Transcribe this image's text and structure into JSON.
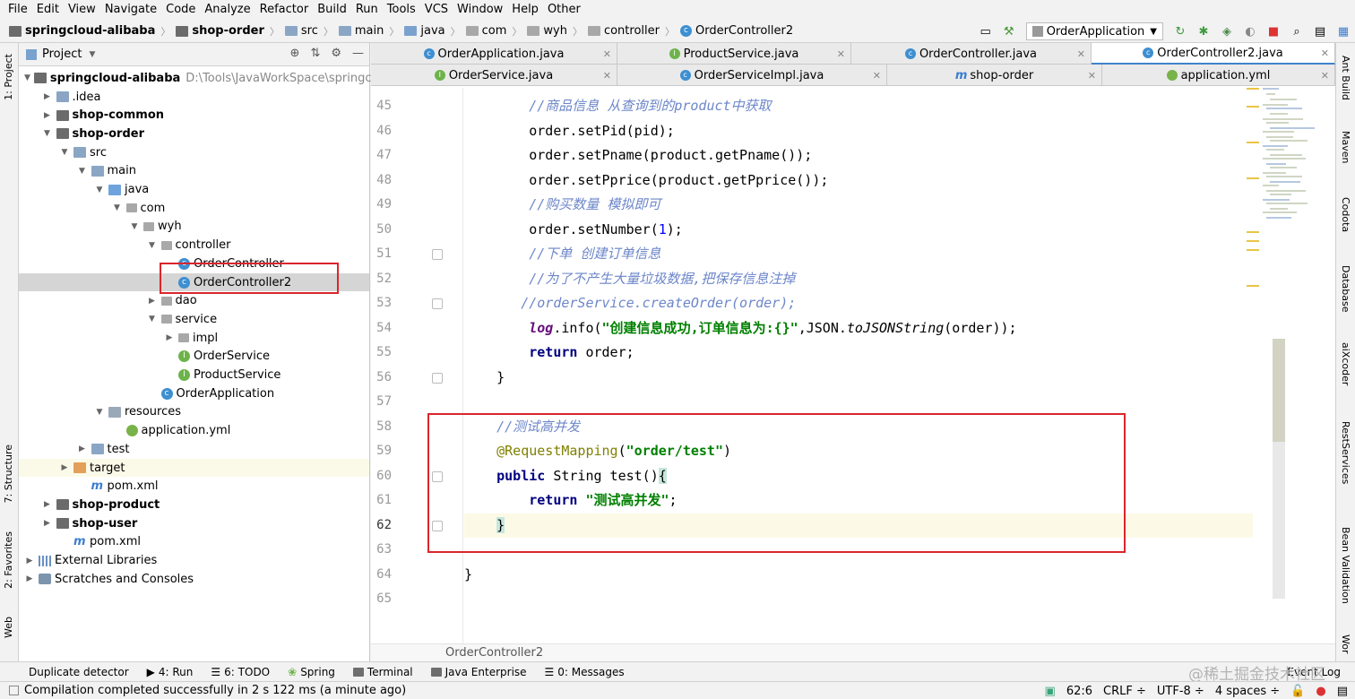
{
  "menu": [
    "File",
    "Edit",
    "View",
    "Navigate",
    "Code",
    "Analyze",
    "Refactor",
    "Build",
    "Run",
    "Tools",
    "VCS",
    "Window",
    "Help",
    "Other"
  ],
  "breadcrumb": {
    "project": "springcloud-alibaba",
    "module": "shop-order",
    "items": [
      "src",
      "main",
      "java",
      "com",
      "wyh",
      "controller"
    ],
    "file": "OrderController2"
  },
  "run_config": "OrderApplication",
  "left_tabs": [
    "1: Project",
    "7: Structure",
    "2: Favorites",
    "Web"
  ],
  "right_tabs": [
    "Ant Build",
    "Maven",
    "Codota",
    "Database",
    "aiXcoder",
    "RestServices",
    "Bean Validation",
    "Wor"
  ],
  "project_panel": {
    "title": "Project",
    "tree": [
      {
        "label": "springcloud-alibaba",
        "path": "D:\\Tools\\JavaWorkSpace\\springcloud-al",
        "icon": "module-folder-icon",
        "bold": true,
        "arrow": "▼",
        "indent": 0
      },
      {
        "label": ".idea",
        "icon": "folder-icon",
        "arrow": "▶",
        "indent": 1
      },
      {
        "label": "shop-common",
        "icon": "module-folder-icon",
        "bold": true,
        "arrow": "▶",
        "indent": 1
      },
      {
        "label": "shop-order",
        "icon": "module-folder-icon",
        "bold": true,
        "arrow": "▼",
        "indent": 1
      },
      {
        "label": "src",
        "icon": "folder-icon",
        "arrow": "▼",
        "indent": 2
      },
      {
        "label": "main",
        "icon": "folder-icon",
        "arrow": "▼",
        "indent": 3
      },
      {
        "label": "java",
        "icon": "source-folder-icon",
        "arrow": "▼",
        "indent": 4
      },
      {
        "label": "com",
        "icon": "package-icon",
        "arrow": "▼",
        "indent": 5
      },
      {
        "label": "wyh",
        "icon": "package-icon",
        "arrow": "▼",
        "indent": 6
      },
      {
        "label": "controller",
        "icon": "package-icon",
        "arrow": "▼",
        "indent": 7
      },
      {
        "label": "OrderController",
        "icon": "class-icon",
        "arrow": "",
        "indent": 8
      },
      {
        "label": "OrderController2",
        "icon": "class-icon",
        "arrow": "",
        "indent": 8,
        "selected": true
      },
      {
        "label": "dao",
        "icon": "package-icon",
        "arrow": "▶",
        "indent": 7
      },
      {
        "label": "service",
        "icon": "package-icon",
        "arrow": "▼",
        "indent": 7
      },
      {
        "label": "impl",
        "icon": "package-icon",
        "arrow": "▶",
        "indent": 8
      },
      {
        "label": "OrderService",
        "icon": "interface-icon",
        "arrow": "",
        "indent": 8
      },
      {
        "label": "ProductService",
        "icon": "interface-icon",
        "arrow": "",
        "indent": 8
      },
      {
        "label": "OrderApplication",
        "icon": "class-icon",
        "arrow": "",
        "indent": 7
      },
      {
        "label": "resources",
        "icon": "resources-folder-icon",
        "arrow": "▼",
        "indent": 4
      },
      {
        "label": "application.yml",
        "icon": "yml-icon",
        "arrow": "",
        "indent": 5
      },
      {
        "label": "test",
        "icon": "folder-icon",
        "arrow": "▶",
        "indent": 3
      },
      {
        "label": "target",
        "icon": "target-folder-icon",
        "arrow": "▶",
        "indent": 2,
        "highlight": true
      },
      {
        "label": "pom.xml",
        "icon": "maven-icon",
        "arrow": "",
        "indent": 3
      },
      {
        "label": "shop-product",
        "icon": "module-folder-icon",
        "bold": true,
        "arrow": "▶",
        "indent": 1
      },
      {
        "label": "shop-user",
        "icon": "module-folder-icon",
        "bold": true,
        "arrow": "▶",
        "indent": 1
      },
      {
        "label": "pom.xml",
        "icon": "maven-icon",
        "arrow": "",
        "indent": 2
      },
      {
        "label": "External Libraries",
        "icon": "library-icon",
        "arrow": "▶",
        "indent": 0
      },
      {
        "label": "Scratches and Consoles",
        "icon": "scratches-icon",
        "arrow": "▶",
        "indent": 0
      }
    ]
  },
  "tabs_row1": [
    {
      "label": "OrderApplication.java",
      "icon": "class"
    },
    {
      "label": "ProductService.java",
      "icon": "interface"
    },
    {
      "label": "OrderController.java",
      "icon": "class"
    },
    {
      "label": "OrderController2.java",
      "icon": "class",
      "active": true
    }
  ],
  "tabs_row2": [
    {
      "label": "OrderService.java",
      "icon": "interface"
    },
    {
      "label": "OrderServiceImpl.java",
      "icon": "class"
    },
    {
      "label": "shop-order",
      "icon": "maven"
    },
    {
      "label": "application.yml",
      "icon": "yml"
    }
  ],
  "code": {
    "line_numbers": [
      "45",
      "46",
      "47",
      "48",
      "49",
      "50",
      "51",
      "52",
      "53",
      "54",
      "55",
      "56",
      "57",
      "58",
      "59",
      "60",
      "61",
      "62",
      "63",
      "64",
      "65"
    ],
    "current_line": "62",
    "comment_45": "//商品信息 从查询到的product中获取",
    "text_46": "order.setPid(pid);",
    "text_47": "order.setPname(product.getPname());",
    "text_48": "order.setPprice(product.getPprice());",
    "comment_49": "//购买数量 模拟即可",
    "text_50a": "order.setNumber(",
    "num_50": "1",
    "text_50b": ");",
    "comment_51": "//下单 创建订单信息",
    "comment_52": "//为了不产生大量垃圾数据,把保存信息注掉",
    "comment_53": "//orderService.createOrder(order);",
    "field_54": "log",
    "text_54a": ".info(",
    "str_54": "\"创建信息成功,订单信息为:{}\"",
    "text_54b": ",JSON.",
    "static_54": "toJSONString",
    "text_54c": "(order));",
    "kw_55": "return",
    "text_55": " order;",
    "brace_56": "}",
    "comment_58": "//测试高并发",
    "ann_59": "@RequestMapping",
    "text_59a": "(",
    "str_59": "\"order/test\"",
    "text_59b": ")",
    "kw_60": "public",
    "text_60": " String test()",
    "brace_60": "{",
    "kw_61": "return",
    "str_61": "\"测试高并发\"",
    "text_61": ";",
    "brace_62": "}",
    "brace_64": "}"
  },
  "editor_footer": "OrderController2",
  "bottom_tools": [
    "Duplicate detector",
    "4: Run",
    "6: TODO",
    "Spring",
    "Terminal",
    "Java Enterprise",
    "0: Messages"
  ],
  "event_log": "Event Log",
  "status": {
    "message": "Compilation completed successfully in 2 s 122 ms (a minute ago)",
    "position": "62:6",
    "line_sep": "CRLF ÷",
    "encoding": "UTF-8 ÷",
    "indent": "4 spaces ÷"
  },
  "watermark": "@稀土掘金技术社区"
}
